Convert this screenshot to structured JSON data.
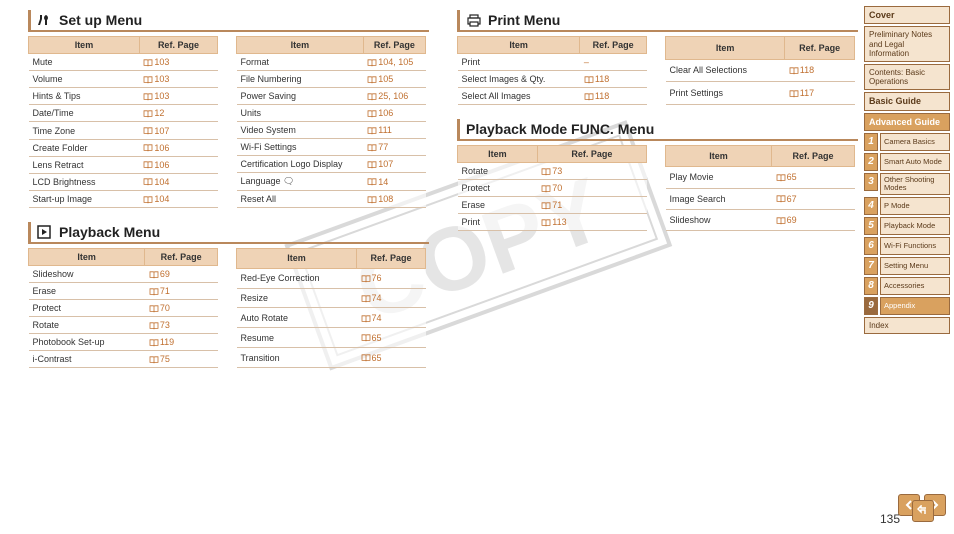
{
  "page_number": "135",
  "sections": {
    "setup": {
      "title": "Set up Menu",
      "col_header_item": "Item",
      "col_header_ref": "Ref. Page",
      "left": [
        {
          "item": "Mute",
          "ref": "103"
        },
        {
          "item": "Volume",
          "ref": "103"
        },
        {
          "item": "Hints & Tips",
          "ref": "103"
        },
        {
          "item": "Date/Time",
          "ref": "12"
        },
        {
          "item": "Time Zone",
          "ref": "107"
        },
        {
          "item": "Create Folder",
          "ref": "106"
        },
        {
          "item": "Lens Retract",
          "ref": "106"
        },
        {
          "item": "LCD Brightness",
          "ref": "104"
        },
        {
          "item": "Start-up Image",
          "ref": "104"
        }
      ],
      "right": [
        {
          "item": "Format",
          "ref": "104, 105"
        },
        {
          "item": "File Numbering",
          "ref": "105"
        },
        {
          "item": "Power Saving",
          "ref": "25, 106"
        },
        {
          "item": "Units",
          "ref": "106"
        },
        {
          "item": "Video System",
          "ref": "111"
        },
        {
          "item": "Wi-Fi Settings",
          "ref": "77"
        },
        {
          "item": "Certification Logo Display",
          "ref": "107"
        },
        {
          "item": "Language 🗨",
          "ref": "14"
        },
        {
          "item": "Reset All",
          "ref": "108"
        }
      ]
    },
    "playback": {
      "title": "Playback Menu",
      "left": [
        {
          "item": "Slideshow",
          "ref": "69"
        },
        {
          "item": "Erase",
          "ref": "71"
        },
        {
          "item": "Protect",
          "ref": "70"
        },
        {
          "item": "Rotate",
          "ref": "73"
        },
        {
          "item": "Photobook Set-up",
          "ref": "119"
        },
        {
          "item": "i-Contrast",
          "ref": "75"
        }
      ],
      "right": [
        {
          "item": "Red-Eye Correction",
          "ref": "76"
        },
        {
          "item": "Resize",
          "ref": "74"
        },
        {
          "item": "Auto Rotate",
          "ref": "74"
        },
        {
          "item": "Resume",
          "ref": "65"
        },
        {
          "item": "Transition",
          "ref": "65"
        }
      ]
    },
    "print": {
      "title": "Print Menu",
      "left": [
        {
          "item": "Print",
          "ref": "–"
        },
        {
          "item": "Select Images & Qty.",
          "ref": "118"
        },
        {
          "item": "Select All Images",
          "ref": "118"
        }
      ],
      "right": [
        {
          "item": "Clear All Selections",
          "ref": "118"
        },
        {
          "item": "Print Settings",
          "ref": "117"
        }
      ]
    },
    "func": {
      "title": "Playback Mode FUNC. Menu",
      "left": [
        {
          "item": "Rotate",
          "ref": "73"
        },
        {
          "item": "Protect",
          "ref": "70"
        },
        {
          "item": "Erase",
          "ref": "71"
        },
        {
          "item": "Print",
          "ref": "113"
        }
      ],
      "right": [
        {
          "item": "Play Movie",
          "ref": "65"
        },
        {
          "item": "Image Search",
          "ref": "67"
        },
        {
          "item": "Slideshow",
          "ref": "69"
        }
      ]
    }
  },
  "sidebar": {
    "cover": "Cover",
    "prelim": "Preliminary Notes and Legal Information",
    "contents": "Contents: Basic Operations",
    "basic": "Basic Guide",
    "advanced": "Advanced Guide",
    "chapters": [
      {
        "n": "1",
        "label": "Camera Basics"
      },
      {
        "n": "2",
        "label": "Smart Auto Mode"
      },
      {
        "n": "3",
        "label": "Other Shooting Modes"
      },
      {
        "n": "4",
        "label": "P Mode"
      },
      {
        "n": "5",
        "label": "Playback Mode"
      },
      {
        "n": "6",
        "label": "Wi-Fi Functions"
      },
      {
        "n": "7",
        "label": "Setting Menu"
      },
      {
        "n": "8",
        "label": "Accessories"
      },
      {
        "n": "9",
        "label": "Appendix"
      }
    ],
    "index": "Index"
  },
  "watermark": "COPY"
}
